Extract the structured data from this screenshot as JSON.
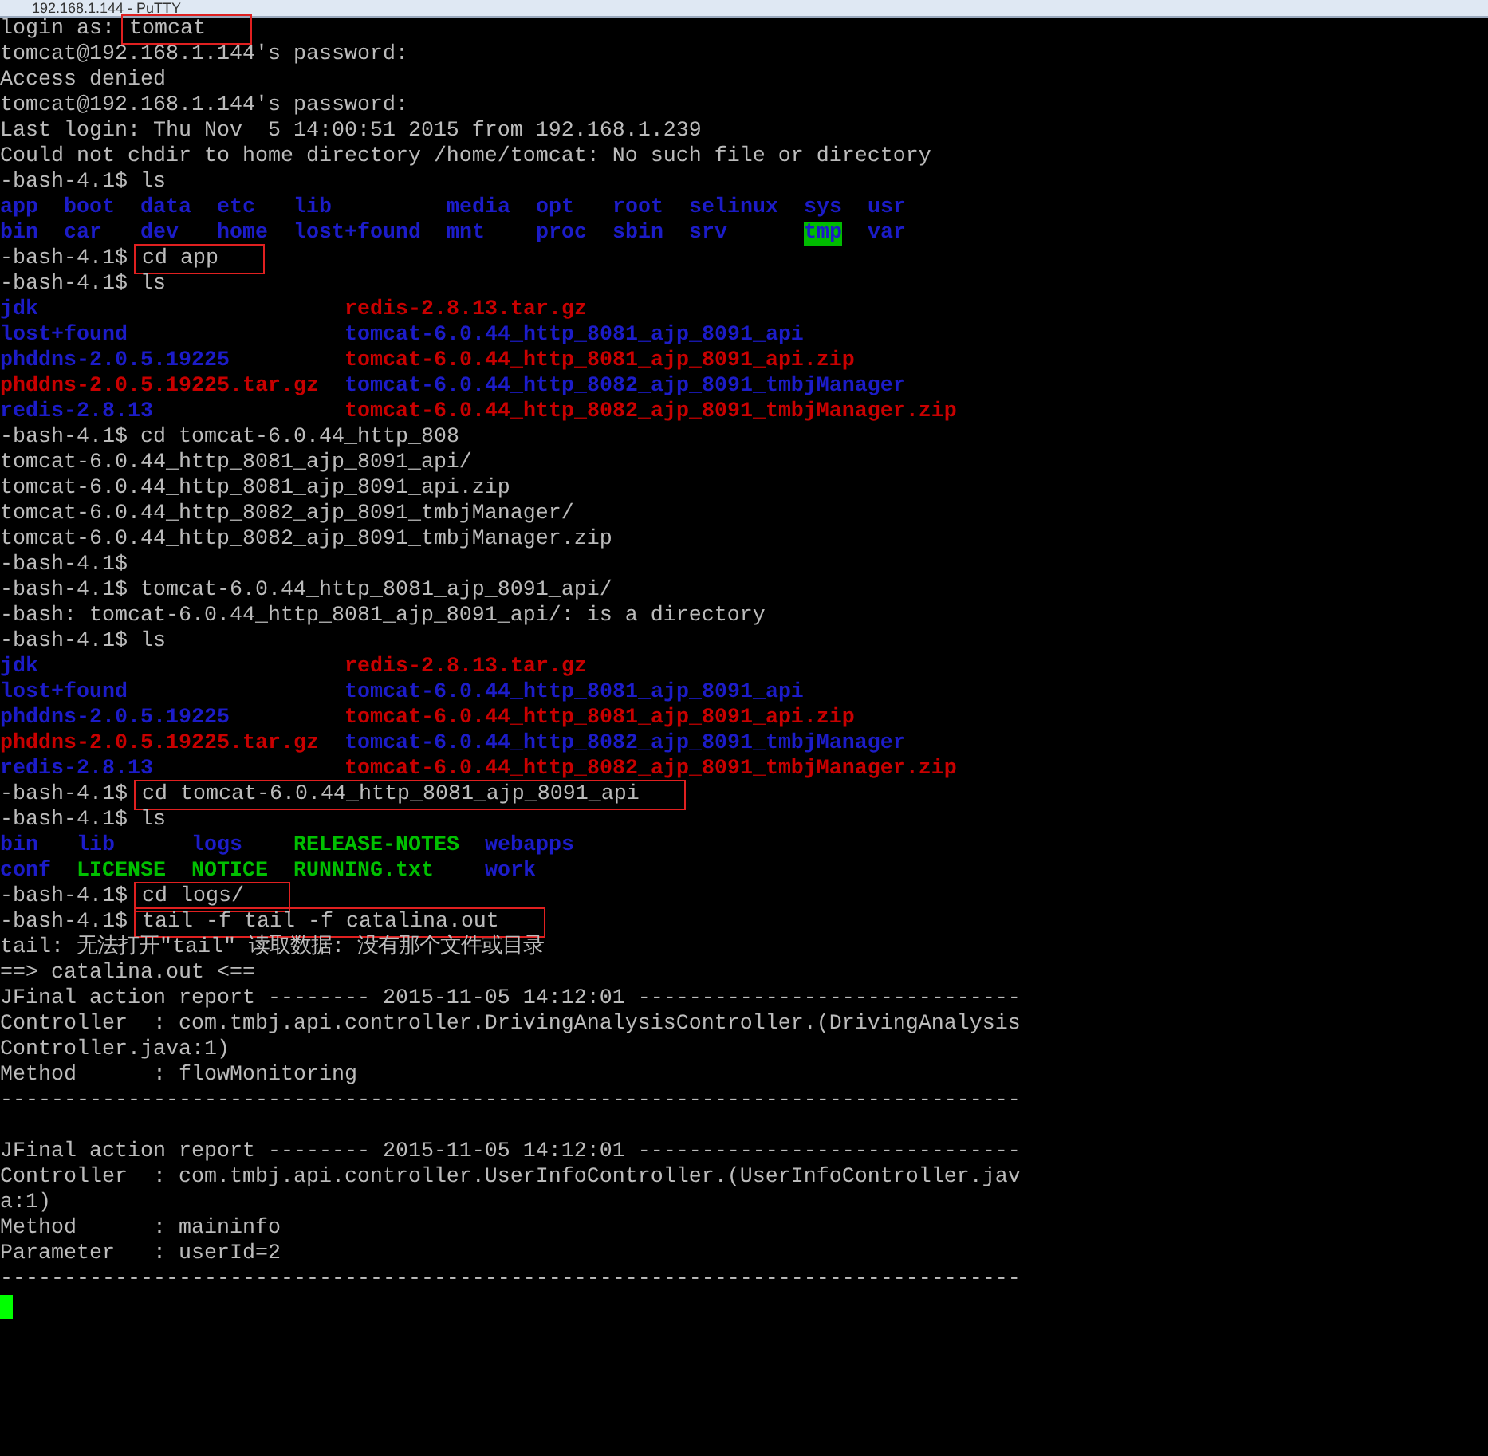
{
  "window": {
    "title": "192.168.1.144 - PuTTY"
  },
  "lines": [
    {
      "kind": "prompt",
      "prompt": "login as:",
      "command": "tomcat",
      "boxed": true
    },
    {
      "kind": "output",
      "text": "tomcat@192.168.1.144's password:"
    },
    {
      "kind": "output",
      "text": "Access denied"
    },
    {
      "kind": "output",
      "text": "tomcat@192.168.1.144's password:"
    },
    {
      "kind": "output",
      "text": "Last login: Thu Nov  5 14:00:51 2015 from 192.168.1.239"
    },
    {
      "kind": "output",
      "text": "Could not chdir to home directory /home/tomcat: No such file or directory"
    },
    {
      "kind": "prompt",
      "prompt": "-bash-4.1$",
      "command": "ls",
      "boxed": false
    },
    {
      "kind": "listing",
      "rows": [
        [
          {
            "name": "app",
            "kind": "dir"
          },
          {
            "name": "boot",
            "kind": "dir"
          },
          {
            "name": "data",
            "kind": "dir"
          },
          {
            "name": "etc",
            "kind": "dir"
          },
          {
            "name": "lib",
            "kind": "dir"
          },
          {
            "name": "media",
            "kind": "dir"
          },
          {
            "name": "opt",
            "kind": "dir"
          },
          {
            "name": "root",
            "kind": "dir"
          },
          {
            "name": "selinux",
            "kind": "dir"
          },
          {
            "name": "sys",
            "kind": "dir"
          },
          {
            "name": "usr",
            "kind": "dir"
          }
        ],
        [
          {
            "name": "bin",
            "kind": "dir"
          },
          {
            "name": "car",
            "kind": "dir"
          },
          {
            "name": "dev",
            "kind": "dir"
          },
          {
            "name": "home",
            "kind": "dir"
          },
          {
            "name": "lost+found",
            "kind": "dir"
          },
          {
            "name": "mnt",
            "kind": "dir"
          },
          {
            "name": "proc",
            "kind": "dir"
          },
          {
            "name": "sbin",
            "kind": "dir"
          },
          {
            "name": "srv",
            "kind": "dir"
          },
          {
            "name": "tmp",
            "kind": "sticky"
          },
          {
            "name": "var",
            "kind": "dir"
          }
        ]
      ]
    },
    {
      "kind": "prompt",
      "prompt": "-bash-4.1$",
      "command": "cd app",
      "boxed": true
    },
    {
      "kind": "prompt",
      "prompt": "-bash-4.1$",
      "command": "ls",
      "boxed": false
    },
    {
      "kind": "listing",
      "rows": [
        [
          {
            "name": "jdk",
            "kind": "dir"
          },
          {
            "name": "redis-2.8.13.tar.gz",
            "kind": "archive"
          }
        ],
        [
          {
            "name": "lost+found",
            "kind": "dir"
          },
          {
            "name": "tomcat-6.0.44_http_8081_ajp_8091_api",
            "kind": "dir"
          }
        ],
        [
          {
            "name": "phddns-2.0.5.19225",
            "kind": "dir"
          },
          {
            "name": "tomcat-6.0.44_http_8081_ajp_8091_api.zip",
            "kind": "archive"
          }
        ],
        [
          {
            "name": "phddns-2.0.5.19225.tar.gz",
            "kind": "archive"
          },
          {
            "name": "tomcat-6.0.44_http_8082_ajp_8091_tmbjManager",
            "kind": "dir"
          }
        ],
        [
          {
            "name": "redis-2.8.13",
            "kind": "dir"
          },
          {
            "name": "tomcat-6.0.44_http_8082_ajp_8091_tmbjManager.zip",
            "kind": "archive"
          }
        ]
      ]
    },
    {
      "kind": "prompt",
      "prompt": "-bash-4.1$",
      "command": "cd tomcat-6.0.44_http_808",
      "boxed": false
    },
    {
      "kind": "output",
      "text": "tomcat-6.0.44_http_8081_ajp_8091_api/"
    },
    {
      "kind": "output",
      "text": "tomcat-6.0.44_http_8081_ajp_8091_api.zip"
    },
    {
      "kind": "output",
      "text": "tomcat-6.0.44_http_8082_ajp_8091_tmbjManager/"
    },
    {
      "kind": "output",
      "text": "tomcat-6.0.44_http_8082_ajp_8091_tmbjManager.zip"
    },
    {
      "kind": "prompt",
      "prompt": "-bash-4.1$",
      "boxed": false
    },
    {
      "kind": "prompt",
      "prompt": "-bash-4.1$",
      "command": "tomcat-6.0.44_http_8081_ajp_8091_api/",
      "boxed": false
    },
    {
      "kind": "output",
      "text": "-bash: tomcat-6.0.44_http_8081_ajp_8091_api/: is a directory"
    },
    {
      "kind": "prompt",
      "prompt": "-bash-4.1$",
      "command": "ls",
      "boxed": false
    },
    {
      "kind": "listing",
      "rows": [
        [
          {
            "name": "jdk",
            "kind": "dir"
          },
          {
            "name": "redis-2.8.13.tar.gz",
            "kind": "archive"
          }
        ],
        [
          {
            "name": "lost+found",
            "kind": "dir"
          },
          {
            "name": "tomcat-6.0.44_http_8081_ajp_8091_api",
            "kind": "dir"
          }
        ],
        [
          {
            "name": "phddns-2.0.5.19225",
            "kind": "dir"
          },
          {
            "name": "tomcat-6.0.44_http_8081_ajp_8091_api.zip",
            "kind": "archive"
          }
        ],
        [
          {
            "name": "phddns-2.0.5.19225.tar.gz",
            "kind": "archive"
          },
          {
            "name": "tomcat-6.0.44_http_8082_ajp_8091_tmbjManager",
            "kind": "dir"
          }
        ],
        [
          {
            "name": "redis-2.8.13",
            "kind": "dir"
          },
          {
            "name": "tomcat-6.0.44_http_8082_ajp_8091_tmbjManager.zip",
            "kind": "archive"
          }
        ]
      ]
    },
    {
      "kind": "prompt",
      "prompt": "-bash-4.1$",
      "command": "cd tomcat-6.0.44_http_8081_ajp_8091_api",
      "boxed": true
    },
    {
      "kind": "prompt",
      "prompt": "-bash-4.1$",
      "command": "ls",
      "boxed": false
    },
    {
      "kind": "listing",
      "rows": [
        [
          {
            "name": "bin",
            "kind": "dir"
          },
          {
            "name": "lib",
            "kind": "dir"
          },
          {
            "name": "logs",
            "kind": "dir"
          },
          {
            "name": "RELEASE-NOTES",
            "kind": "exec"
          },
          {
            "name": "webapps",
            "kind": "dir"
          }
        ],
        [
          {
            "name": "conf",
            "kind": "dir"
          },
          {
            "name": "LICENSE",
            "kind": "exec"
          },
          {
            "name": "NOTICE",
            "kind": "exec"
          },
          {
            "name": "RUNNING.txt",
            "kind": "exec"
          },
          {
            "name": "work",
            "kind": "dir"
          }
        ]
      ]
    },
    {
      "kind": "prompt",
      "prompt": "-bash-4.1$",
      "command": "cd logs/",
      "boxed": true
    },
    {
      "kind": "prompt",
      "prompt": "-bash-4.1$",
      "command": "tail -f tail -f catalina.out",
      "boxed": true
    },
    {
      "kind": "output",
      "text": "tail: 无法打开\"tail\" 读取数据: 没有那个文件或目录"
    },
    {
      "kind": "output",
      "text": "==> catalina.out <=="
    },
    {
      "kind": "output",
      "text": "JFinal action report -------- 2015-11-05 14:12:01 ------------------------------"
    },
    {
      "kind": "output",
      "text": "Controller  : com.tmbj.api.controller.DrivingAnalysisController.(DrivingAnalysis"
    },
    {
      "kind": "output",
      "text": "Controller.java:1)"
    },
    {
      "kind": "output",
      "text": "Method      : flowMonitoring"
    },
    {
      "kind": "output",
      "text": "--------------------------------------------------------------------------------"
    },
    {
      "kind": "blank"
    },
    {
      "kind": "output",
      "text": "JFinal action report -------- 2015-11-05 14:12:01 ------------------------------"
    },
    {
      "kind": "output",
      "text": "Controller  : com.tmbj.api.controller.UserInfoController.(UserInfoController.jav"
    },
    {
      "kind": "output",
      "text": "a:1)"
    },
    {
      "kind": "output",
      "text": "Method      : maininfo"
    },
    {
      "kind": "output",
      "text": "Parameter   : userId=2"
    },
    {
      "kind": "output",
      "text": "--------------------------------------------------------------------------------"
    },
    {
      "kind": "cursor"
    }
  ]
}
